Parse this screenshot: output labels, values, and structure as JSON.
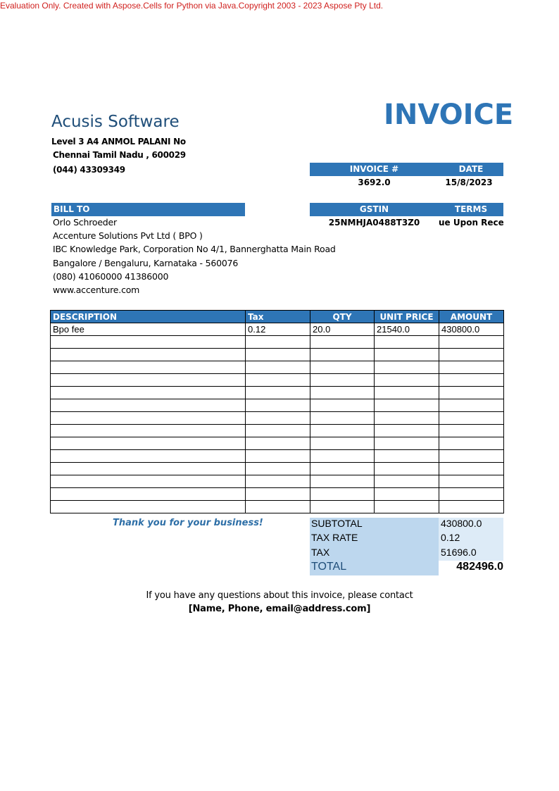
{
  "watermark": "Evaluation Only. Created with Aspose.Cells for Python via Java.Copyright 2003 - 2023 Aspose Pty Ltd.",
  "company": {
    "name": "Acusis Software",
    "address1": "Level 3 A4 ANMOL PALANI No",
    "address2": "Chennai Tamil Nadu , 600029",
    "phone": "(044) 43309349"
  },
  "title": "INVOICE",
  "invoice_meta": {
    "number_label": "INVOICE #",
    "date_label": "DATE",
    "number": "3692.0",
    "date": "15/8/2023",
    "gstin_label": "GSTIN",
    "terms_label": "TERMS",
    "gstin": "25NMHJA0488T3Z0",
    "terms": "ue Upon Receip"
  },
  "bill_to": {
    "label": "BILL TO",
    "lines": [
      "Orlo Schroeder",
      "Accenture Solutions Pvt Ltd ( BPO )",
      "IBC Knowledge Park, Corporation No 4/1, Bannerghatta Main Road",
      "Bangalore / Bengaluru, Karnataka - 560076",
      "(080) 41060000  41386000",
      "www.accenture.com"
    ]
  },
  "items": {
    "headers": [
      "DESCRIPTION",
      "Tax",
      "QTY",
      "UNIT PRICE",
      "AMOUNT"
    ],
    "rows": [
      [
        "Bpo fee",
        "0.12",
        "20.0",
        "21540.0",
        "430800.0"
      ]
    ],
    "empty_rows": 14
  },
  "thanks": "Thank you for your business!",
  "totals": {
    "subtotal_label": "SUBTOTAL",
    "subtotal": "430800.0",
    "tax_rate_label": "TAX RATE",
    "tax_rate": "0.12",
    "tax_label": "TAX",
    "tax": "51696.0",
    "total_label": "TOTAL",
    "total": "482496.0"
  },
  "contact": {
    "line1": "If you have any questions about this invoice, please contact",
    "line2": "[Name, Phone, email@address.com]"
  },
  "colors": {
    "header_blue": "#2e75b6",
    "company_navy": "#1f4e79",
    "totals_label_bg": "#bdd7ee",
    "totals_value_bg": "#ddebf7",
    "watermark_red": "#d0201e"
  }
}
